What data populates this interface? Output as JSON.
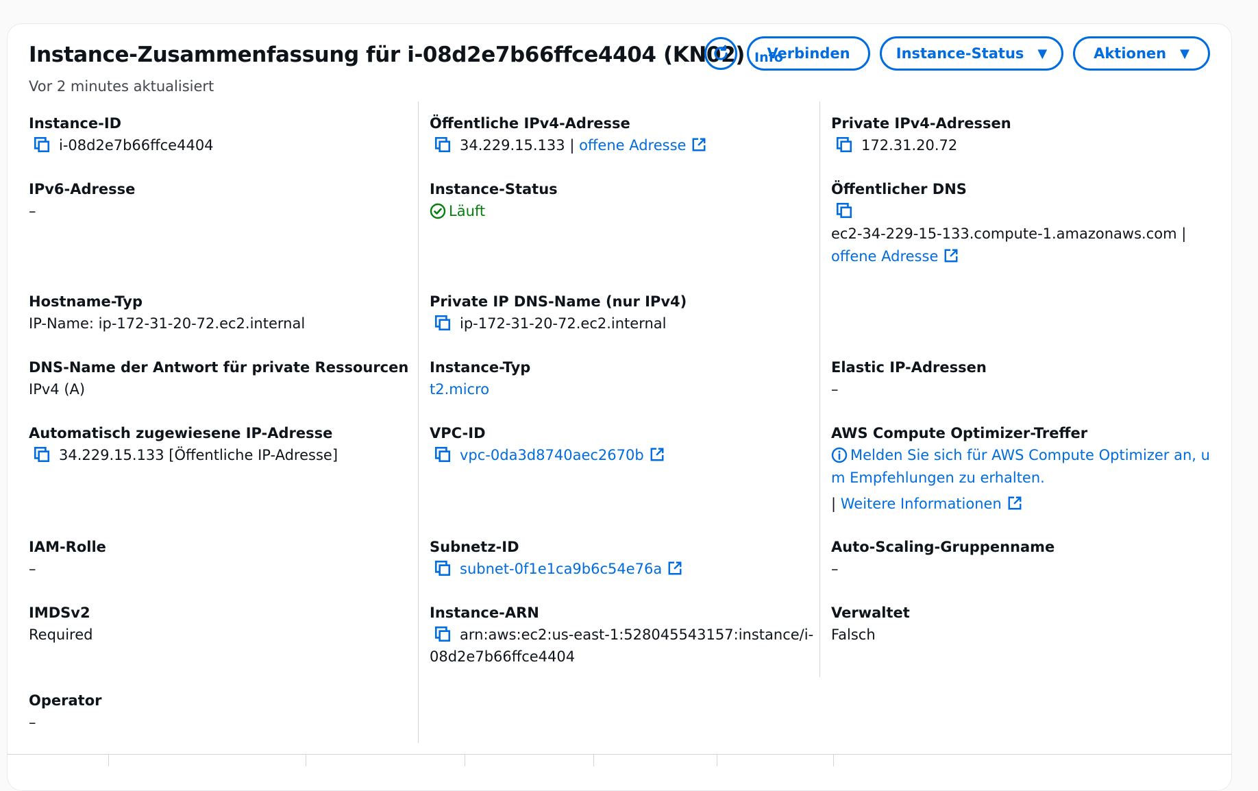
{
  "header": {
    "title": "Instance-Zusammenfassung für i-08d2e7b66ffce4404 (KN02)",
    "info": "Info",
    "updated": "Vor 2 minutes aktualisiert",
    "buttons": {
      "connect": "Verbinden",
      "instance_state": "Instance-Status",
      "actions": "Aktionen"
    }
  },
  "col1": {
    "instance_id": {
      "label": "Instance-ID",
      "value": "i-08d2e7b66ffce4404"
    },
    "ipv6": {
      "label": "IPv6-Adresse",
      "value": "–"
    },
    "hostname_type": {
      "label": "Hostname-Typ",
      "value": "IP-Name: ip-172-31-20-72.ec2.internal"
    },
    "dns_answer": {
      "label": "DNS-Name der Antwort für private Ressourcen",
      "value": "IPv4 (A)"
    },
    "auto_ip": {
      "label": "Automatisch zugewiesene IP-Adresse",
      "value": "34.229.15.133 [Öffentliche IP-Adresse]"
    },
    "iam_role": {
      "label": "IAM-Rolle",
      "value": "–"
    },
    "imdsv2": {
      "label": "IMDSv2",
      "value": "Required"
    },
    "operator": {
      "label": "Operator",
      "value": "–"
    }
  },
  "col2": {
    "public_ipv4": {
      "label": "Öffentliche IPv4-Adresse",
      "value": "34.229.15.133",
      "sep": " | ",
      "link": "offene Adresse"
    },
    "instance_status": {
      "label": "Instance-Status",
      "value": "Läuft"
    },
    "private_dns": {
      "label": "Private IP DNS-Name (nur IPv4)",
      "value": "ip-172-31-20-72.ec2.internal"
    },
    "instance_type": {
      "label": "Instance-Typ",
      "value": "t2.micro"
    },
    "vpc_id": {
      "label": "VPC-ID",
      "value": "vpc-0da3d8740aec2670b"
    },
    "subnet_id": {
      "label": "Subnetz-ID",
      "value": "subnet-0f1e1ca9b6c54e76a"
    },
    "arn": {
      "label": "Instance-ARN",
      "value_line1": "arn:aws:ec2:us-east-1:528045543157:instance/i-",
      "value_line2": "08d2e7b66ffce4404"
    }
  },
  "col3": {
    "private_ipv4": {
      "label": "Private IPv4-Adressen",
      "value": "172.31.20.72"
    },
    "public_dns": {
      "label": "Öffentlicher DNS",
      "value": "ec2-34-229-15-133.compute-1.amazonaws.com |",
      "link": "offene Adresse"
    },
    "elastic_ip": {
      "label": "Elastic IP-Adressen",
      "value": "–"
    },
    "optimizer": {
      "label": "AWS Compute Optimizer-Treffer",
      "line1": "Melden Sie sich für AWS Compute Optimizer an, u",
      "line2": "m Empfehlungen zu erhalten.",
      "more_prefix": "| ",
      "more_link": "Weitere Informationen"
    },
    "asg": {
      "label": "Auto-Scaling-Gruppenname",
      "value": "–"
    },
    "managed": {
      "label": "Verwaltet",
      "value": "Falsch"
    }
  },
  "colors": {
    "link": "#006ce0",
    "success": "#037f0c",
    "text": "#0f141a",
    "divider": "#d1d5db"
  }
}
